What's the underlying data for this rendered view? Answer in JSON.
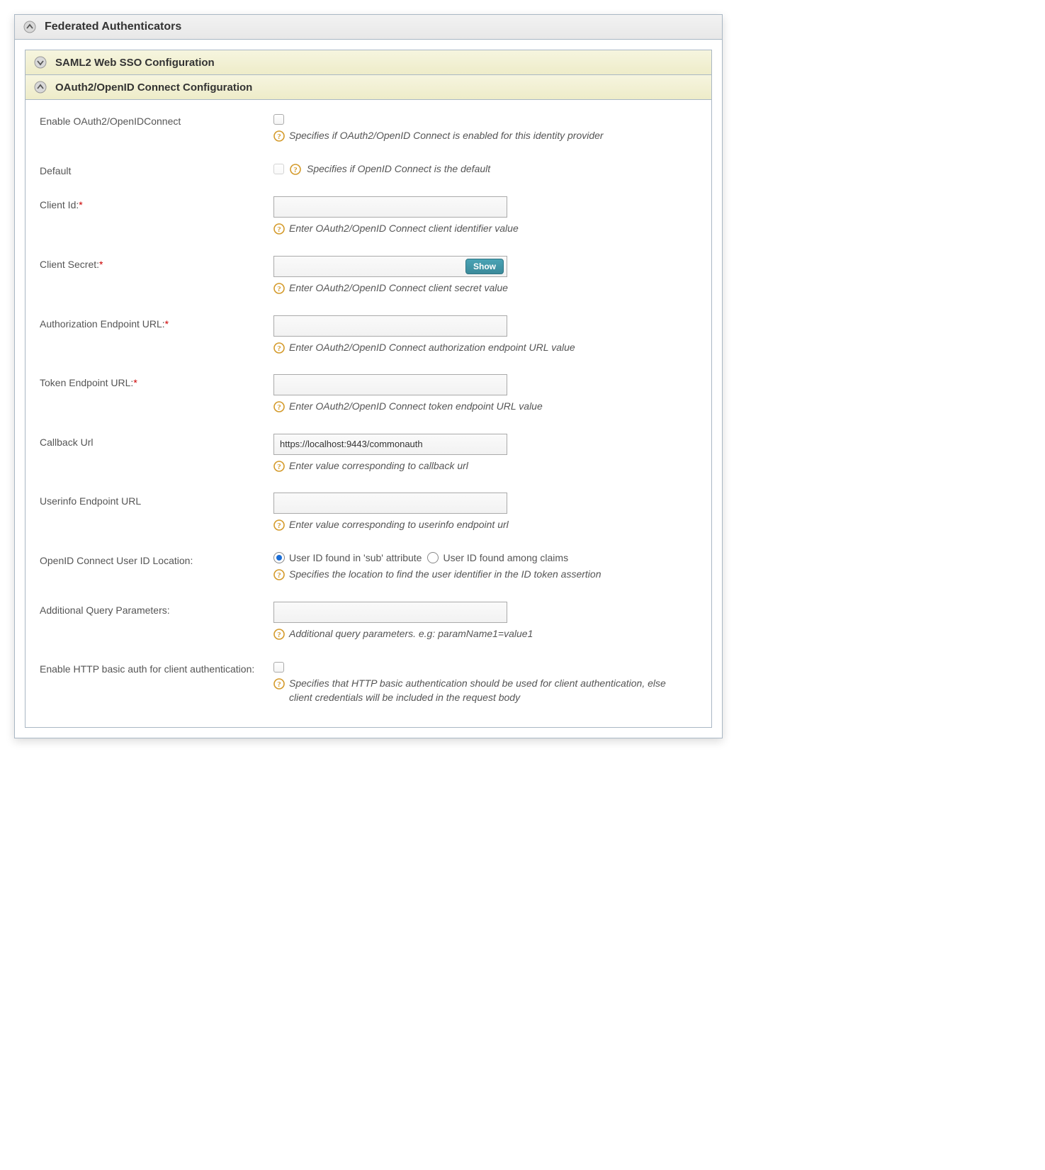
{
  "panel": {
    "title": "Federated Authenticators"
  },
  "sections": {
    "saml": {
      "title": "SAML2 Web SSO Configuration"
    },
    "oauth": {
      "title": "OAuth2/OpenID Connect Configuration"
    }
  },
  "fields": {
    "enable": {
      "label": "Enable OAuth2/OpenIDConnect",
      "help": "Specifies if OAuth2/OpenID Connect is enabled for this identity provider"
    },
    "default": {
      "label": "Default",
      "help": "Specifies if OpenID Connect is the default"
    },
    "client_id": {
      "label": "Client Id:",
      "required": "*",
      "value": "",
      "help": "Enter OAuth2/OpenID Connect client identifier value"
    },
    "client_secret": {
      "label": "Client Secret:",
      "required": "*",
      "value": "",
      "show_label": "Show",
      "help": "Enter OAuth2/OpenID Connect client secret value"
    },
    "authz_url": {
      "label": "Authorization Endpoint URL:",
      "required": "*",
      "value": "",
      "help": "Enter OAuth2/OpenID Connect authorization endpoint URL value"
    },
    "token_url": {
      "label": "Token Endpoint URL:",
      "required": "*",
      "value": "",
      "help": "Enter OAuth2/OpenID Connect token endpoint URL value"
    },
    "callback_url": {
      "label": "Callback Url",
      "value": "https://localhost:9443/commonauth",
      "help": "Enter value corresponding to callback url"
    },
    "userinfo_url": {
      "label": "Userinfo Endpoint URL",
      "value": "",
      "help": "Enter value corresponding to userinfo endpoint url"
    },
    "userid_location": {
      "label": "OpenID Connect User ID Location:",
      "option1": "User ID found in 'sub' attribute",
      "option2": "User ID found among claims",
      "help": "Specifies the location to find the user identifier in the ID token assertion"
    },
    "query_params": {
      "label": "Additional Query Parameters:",
      "value": "",
      "help": "Additional query parameters. e.g: paramName1=value1"
    },
    "basic_auth": {
      "label": "Enable HTTP basic auth for client authentication:",
      "help": "Specifies that HTTP basic authentication should be used for client authentication, else client credentials will be included in the request body"
    }
  }
}
